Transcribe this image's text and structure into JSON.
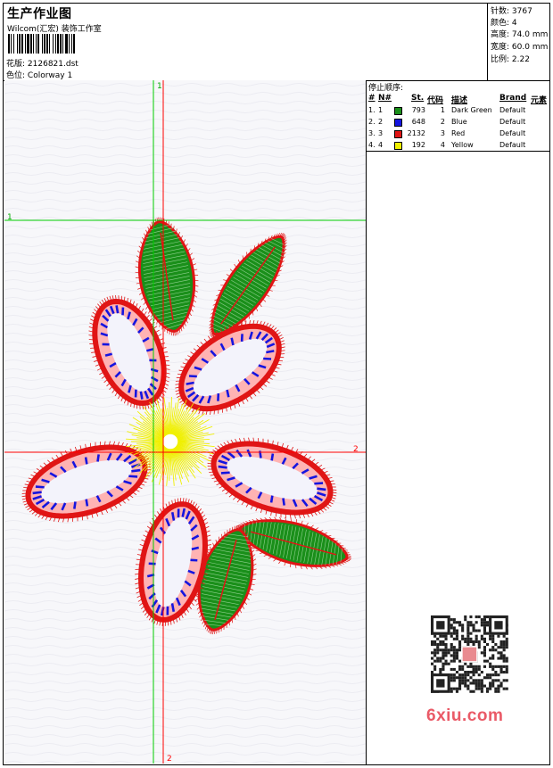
{
  "header": {
    "title": "生产作业图",
    "company": "Wilcom(汇宏) 装饰工作室",
    "design_label": "花版:",
    "design_value": "2126821.dst",
    "colorway_label": "色位:",
    "colorway_value": "Colorway 1"
  },
  "stats": {
    "stitches_label": "针数:",
    "stitches_value": "3767",
    "colors_label": "颜色:",
    "colors_value": "4",
    "height_label": "高度:",
    "height_value": "74.0 mm",
    "width_label": "宽度:",
    "width_value": "60.0 mm",
    "scale_label": "比例:",
    "scale_value": "2.22"
  },
  "guides": {
    "v_green": "1",
    "h_green": "1",
    "h_red": "2",
    "v_red": "2"
  },
  "stop_sequence": {
    "title": "停止顺序:",
    "headers": [
      "#",
      "N#",
      "St.",
      "代码",
      "描述",
      "Brand",
      "元素"
    ],
    "rows": [
      {
        "num": "1.",
        "n": "1",
        "color": "#1a8f1a",
        "stitches": "793",
        "code": "1",
        "desc": "Dark Green",
        "brand": "Default"
      },
      {
        "num": "2.",
        "n": "2",
        "color": "#1515e0",
        "stitches": "648",
        "code": "2",
        "desc": "Blue",
        "brand": "Default"
      },
      {
        "num": "3.",
        "n": "3",
        "color": "#e01515",
        "stitches": "2132",
        "code": "3",
        "desc": "Red",
        "brand": "Default"
      },
      {
        "num": "4.",
        "n": "4",
        "color": "#f0f000",
        "stitches": "192",
        "code": "4",
        "desc": "Yellow",
        "brand": "Default"
      }
    ]
  },
  "watermark": {
    "text": "6xiu.com"
  },
  "colors": {
    "green": "#1a8f1a",
    "blue": "#1515e0",
    "red": "#e01515",
    "yellow": "#f0f000",
    "guide_green": "#00cc00",
    "guide_red": "#ff0000"
  }
}
